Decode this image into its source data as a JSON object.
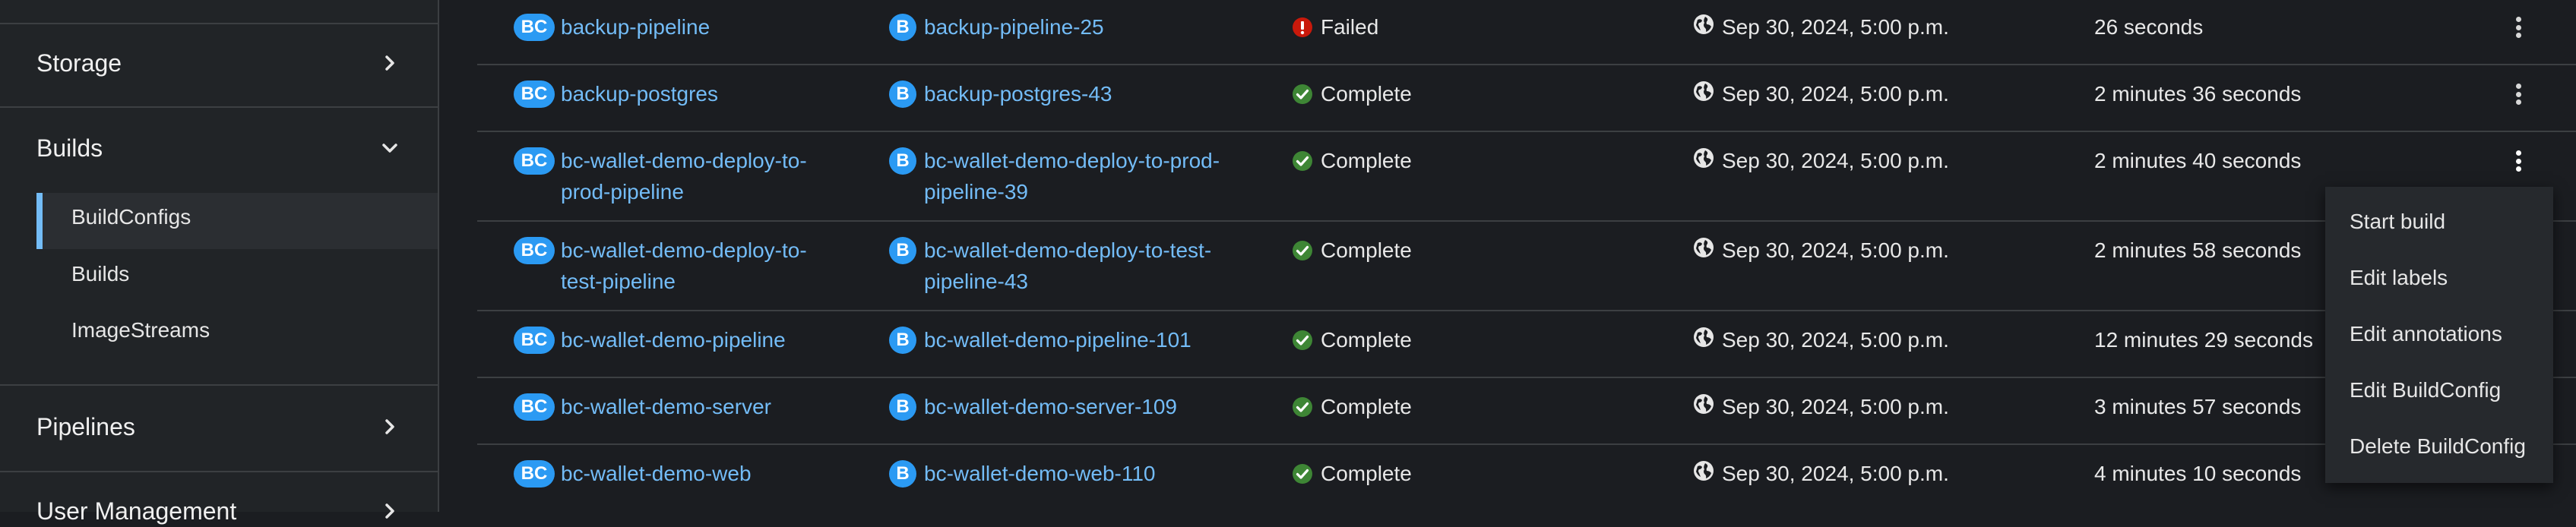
{
  "sidebar": {
    "sections": [
      {
        "label": "Storage",
        "icon": "chevron-right-icon"
      },
      {
        "label": "Builds",
        "icon": "chevron-down-icon"
      },
      {
        "label": "Pipelines",
        "icon": "chevron-right-icon"
      },
      {
        "label": "User Management",
        "icon": "chevron-right-icon"
      }
    ],
    "builds_items": [
      {
        "label": "BuildConfigs",
        "active": true
      },
      {
        "label": "Builds",
        "active": false
      },
      {
        "label": "ImageStreams",
        "active": false
      }
    ]
  },
  "table": {
    "rows": [
      {
        "badge": "BC",
        "name": [
          "backup-pipeline"
        ],
        "build_badge": "B",
        "build": [
          "backup-pipeline-25"
        ],
        "status": "Failed",
        "status_icon": "error-circle-icon",
        "created": "Sep 30, 2024, 5:00 p.m.",
        "duration": "26 seconds"
      },
      {
        "badge": "BC",
        "name": [
          "backup-postgres"
        ],
        "build_badge": "B",
        "build": [
          "backup-postgres-43"
        ],
        "status": "Complete",
        "status_icon": "check-circle-icon",
        "created": "Sep 30, 2024, 5:00 p.m.",
        "duration": "2 minutes 36 seconds"
      },
      {
        "badge": "BC",
        "name": [
          "bc-wallet-demo-deploy-to-",
          "prod-pipeline"
        ],
        "build_badge": "B",
        "build": [
          "bc-wallet-demo-deploy-to-prod-",
          "pipeline-39"
        ],
        "status": "Complete",
        "status_icon": "check-circle-icon",
        "created": "Sep 30, 2024, 5:00 p.m.",
        "duration": "2 minutes 40 seconds"
      },
      {
        "badge": "BC",
        "name": [
          "bc-wallet-demo-deploy-to-",
          "test-pipeline"
        ],
        "build_badge": "B",
        "build": [
          "bc-wallet-demo-deploy-to-test-",
          "pipeline-43"
        ],
        "status": "Complete",
        "status_icon": "check-circle-icon",
        "created": "Sep 30, 2024, 5:00 p.m.",
        "duration": "2 minutes 58 seconds"
      },
      {
        "badge": "BC",
        "name": [
          "bc-wallet-demo-pipeline"
        ],
        "build_badge": "B",
        "build": [
          "bc-wallet-demo-pipeline-101"
        ],
        "status": "Complete",
        "status_icon": "check-circle-icon",
        "created": "Sep 30, 2024, 5:00 p.m.",
        "duration": "12 minutes 29 seconds"
      },
      {
        "badge": "BC",
        "name": [
          "bc-wallet-demo-server"
        ],
        "build_badge": "B",
        "build": [
          "bc-wallet-demo-server-109"
        ],
        "status": "Complete",
        "status_icon": "check-circle-icon",
        "created": "Sep 30, 2024, 5:00 p.m.",
        "duration": "3 minutes 57 seconds"
      },
      {
        "badge": "BC",
        "name": [
          "bc-wallet-demo-web"
        ],
        "build_badge": "B",
        "build": [
          "bc-wallet-demo-web-110"
        ],
        "status": "Complete",
        "status_icon": "check-circle-icon",
        "created": "Sep 30, 2024, 5:00 p.m.",
        "duration": "4 minutes 10 seconds"
      }
    ]
  },
  "menu": {
    "items": [
      "Start build",
      "Edit labels",
      "Edit annotations",
      "Edit BuildConfig",
      "Delete BuildConfig"
    ]
  },
  "colors": {
    "link": "#73bcf7",
    "badge": "#2b9af3",
    "success": "#3e8635",
    "danger": "#c9190b",
    "active_bar": "#73bcf7"
  }
}
